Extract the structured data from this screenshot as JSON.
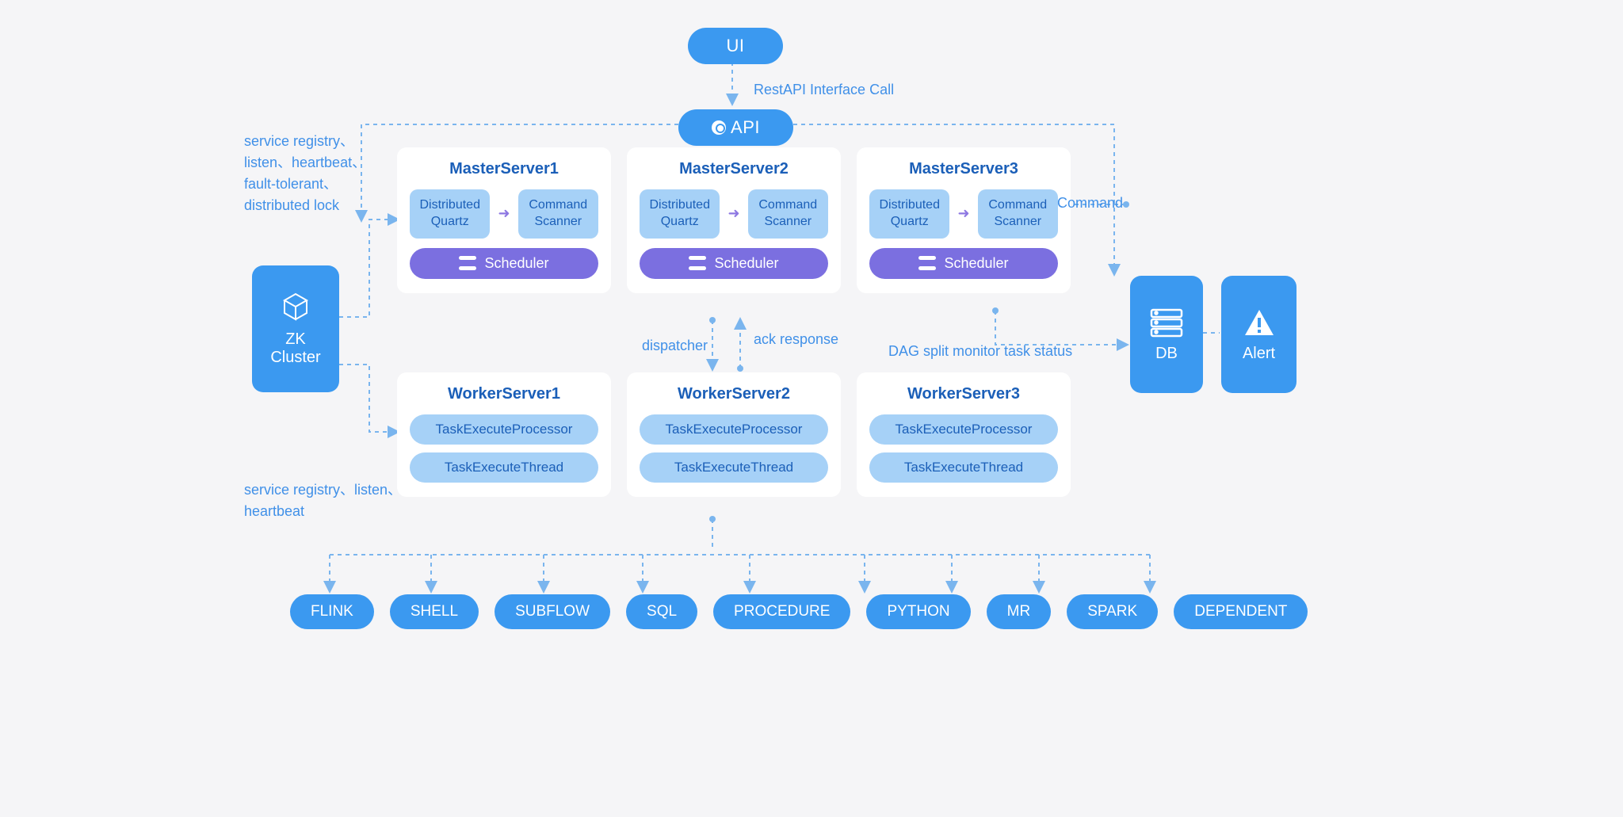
{
  "top": {
    "ui": "UI",
    "api": "API",
    "api_label": "RestAPI Interface Call"
  },
  "zk": {
    "label_line1": "ZK",
    "label_line2": "Cluster",
    "annotation1": "service registry、listen、heartbeat、fault-tolerant、distributed lock",
    "annotation2": "service registry、listen、heartbeat"
  },
  "masters": [
    {
      "title": "MasterServer1",
      "dq": "Distributed Quartz",
      "cs": "Command Scanner",
      "sch": "Scheduler"
    },
    {
      "title": "MasterServer2",
      "dq": "Distributed Quartz",
      "cs": "Command Scanner",
      "sch": "Scheduler"
    },
    {
      "title": "MasterServer3",
      "dq": "Distributed Quartz",
      "cs": "Command Scanner",
      "sch": "Scheduler"
    }
  ],
  "workers": [
    {
      "title": "WorkerServer1",
      "p1": "TaskExecuteProcessor",
      "p2": "TaskExecuteThread"
    },
    {
      "title": "WorkerServer2",
      "p1": "TaskExecuteProcessor",
      "p2": "TaskExecuteThread"
    },
    {
      "title": "WorkerServer3",
      "p1": "TaskExecuteProcessor",
      "p2": "TaskExecuteThread"
    }
  ],
  "mid_labels": {
    "dispatcher": "dispatcher",
    "ack": "ack response",
    "dag": "DAG split monitor task status",
    "command": "Command"
  },
  "right": {
    "db": "DB",
    "alert": "Alert"
  },
  "tasks": [
    "FLINK",
    "SHELL",
    "SUBFLOW",
    "SQL",
    "PROCEDURE",
    "PYTHON",
    "MR",
    "SPARK",
    "DEPENDENT"
  ]
}
